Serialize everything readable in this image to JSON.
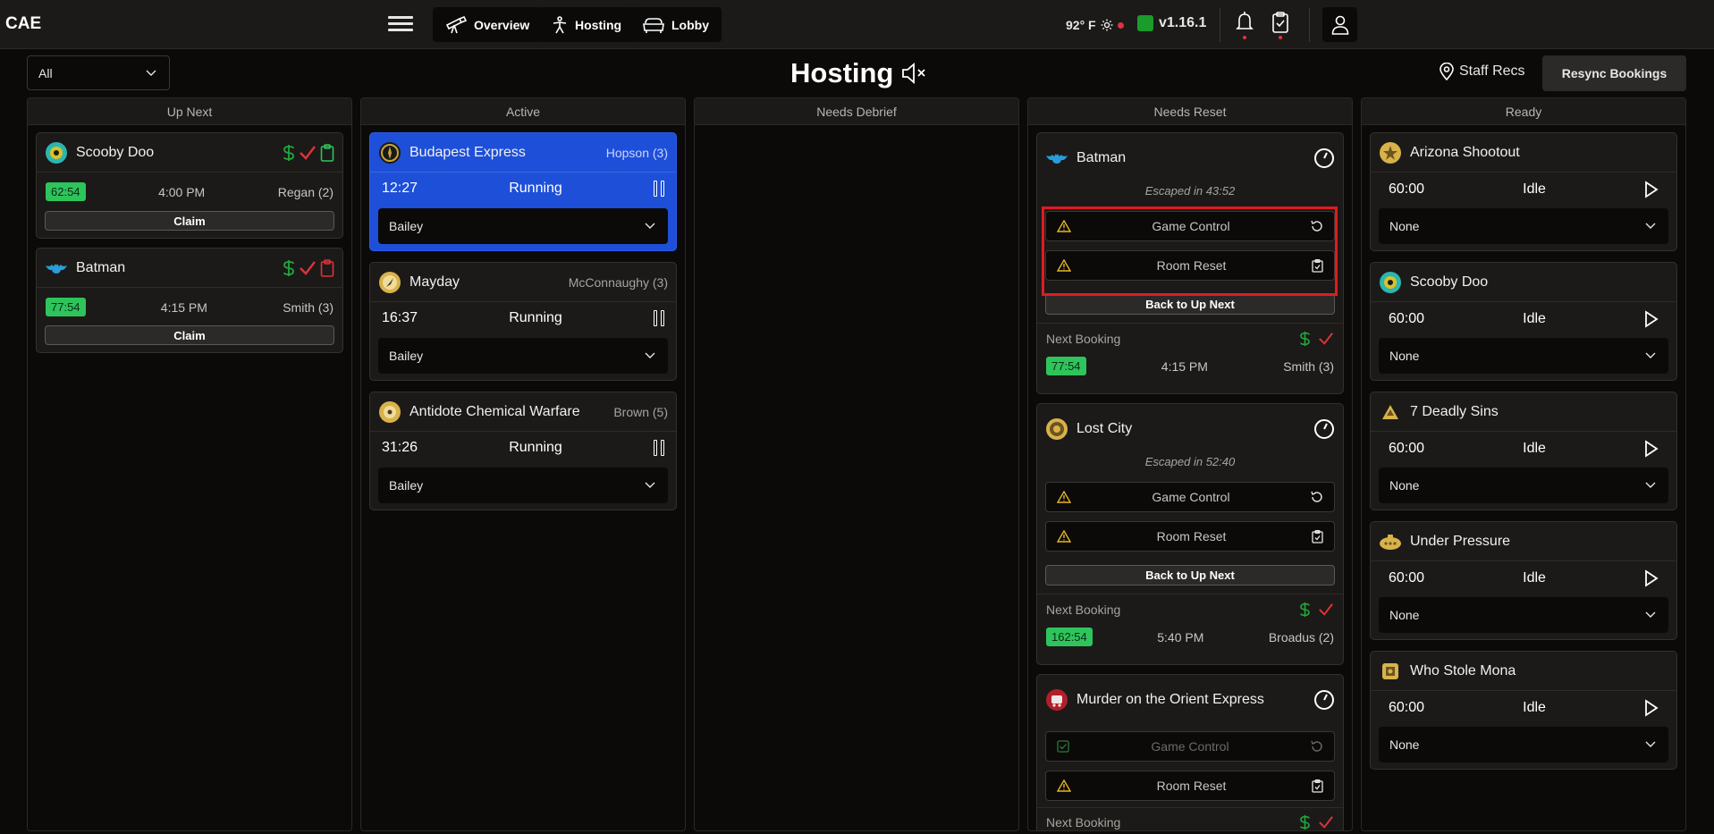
{
  "app": {
    "brand": "CAE"
  },
  "nav": [
    {
      "label": "Overview",
      "icon": "telescope-icon"
    },
    {
      "label": "Hosting",
      "icon": "person-icon"
    },
    {
      "label": "Lobby",
      "icon": "couch-icon"
    }
  ],
  "status": {
    "weather": "92° F",
    "version": "v1.16.1"
  },
  "filter": {
    "value": "All"
  },
  "page": {
    "title": "Hosting",
    "staff_recs": "Staff Recs",
    "resync": "Resync Bookings"
  },
  "columns": [
    "Up Next",
    "Active",
    "Needs Debrief",
    "Needs Reset",
    "Ready"
  ],
  "up_next": [
    {
      "name": "Scooby Doo",
      "time": "62:54",
      "start": "4:00 PM",
      "host": "Regan (2)",
      "claim": "Claim",
      "clip_color": "#2ec45c"
    },
    {
      "name": "Batman",
      "time": "77:54",
      "start": "4:15 PM",
      "host": "Smith (3)",
      "claim": "Claim",
      "clip_color": "#e0323a"
    }
  ],
  "active": [
    {
      "name": "Budapest Express",
      "host": "Hopson (3)",
      "timer": "12:27",
      "state": "Running",
      "staff": "Bailey"
    },
    {
      "name": "Mayday",
      "host": "McConnaughy (3)",
      "timer": "16:37",
      "state": "Running",
      "staff": "Bailey"
    },
    {
      "name": "Antidote Chemical Warfare",
      "host": "Brown (5)",
      "timer": "31:26",
      "state": "Running",
      "staff": "Bailey"
    }
  ],
  "needs_reset": [
    {
      "name": "Batman",
      "escaped": "Escaped in 43:52",
      "game_control": "Game Control",
      "room_reset": "Room Reset",
      "back": "Back to Up Next",
      "next_label": "Next Booking",
      "next_time": "77:54",
      "next_start": "4:15 PM",
      "next_host": "Smith (3)"
    },
    {
      "name": "Lost City",
      "escaped": "Escaped in 52:40",
      "game_control": "Game Control",
      "room_reset": "Room Reset",
      "back": "Back to Up Next",
      "next_label": "Next Booking",
      "next_time": "162:54",
      "next_start": "5:40 PM",
      "next_host": "Broadus (2)"
    },
    {
      "name": "Murder on the Orient Express",
      "game_control": "Game Control",
      "room_reset": "Room Reset",
      "next_label": "Next Booking"
    }
  ],
  "ready": [
    {
      "name": "Arizona Shootout",
      "timer": "60:00",
      "state": "Idle",
      "staff": "None"
    },
    {
      "name": "Scooby Doo",
      "timer": "60:00",
      "state": "Idle",
      "staff": "None"
    },
    {
      "name": "7 Deadly Sins",
      "timer": "60:00",
      "state": "Idle",
      "staff": "None"
    },
    {
      "name": "Under Pressure",
      "timer": "60:00",
      "state": "Idle",
      "staff": "None"
    },
    {
      "name": "Who Stole Mona",
      "timer": "60:00",
      "state": "Idle",
      "staff": "None"
    }
  ],
  "colors": {
    "accent_blue": "#1e4fd8",
    "pill_green": "#2ec45c",
    "warn": "#e5b627",
    "danger": "#e0323a",
    "money": "#1fa83a"
  }
}
